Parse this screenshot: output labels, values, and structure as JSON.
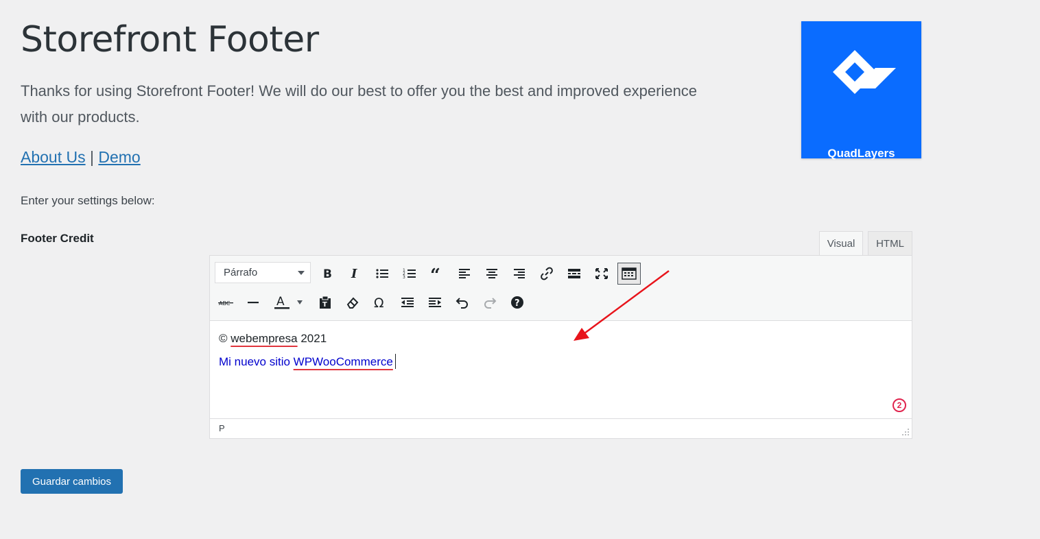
{
  "page": {
    "title": "Storefront Footer",
    "intro": "Thanks for using Storefront Footer! We will do our best to offer you the best and improved experience with our products.",
    "links": {
      "about": "About Us",
      "separator": "|",
      "demo": "Demo"
    },
    "enter_settings": "Enter your settings below:"
  },
  "logo": {
    "text": "QuadLayers",
    "bg_color": "#0a6cff"
  },
  "field": {
    "label": "Footer Credit"
  },
  "editor": {
    "tabs": {
      "visual": "Visual",
      "html": "HTML"
    },
    "format_select": "Párrafo",
    "toolbar_row1": [
      "bold-icon",
      "italic-icon",
      "bullet-list-icon",
      "numbered-list-icon",
      "blockquote-icon",
      "align-left-icon",
      "align-center-icon",
      "align-right-icon",
      "link-icon",
      "read-more-icon",
      "fullscreen-icon",
      "toolbar-toggle-icon"
    ],
    "toolbar_row2": [
      "strikethrough-icon",
      "horizontal-line-icon",
      "text-color-icon",
      "paste-text-icon",
      "clear-formatting-icon",
      "special-character-icon",
      "outdent-icon",
      "indent-icon",
      "undo-icon",
      "redo-icon",
      "help-icon"
    ],
    "content": {
      "line1_symbol": "©",
      "line1_word": "webempresa",
      "line1_year": "2021",
      "line2_prefix": "Mi nuevo sitio",
      "line2_word": "WPWooCommerce",
      "line2_color": "#0000cd"
    },
    "badge": "2",
    "status_path": "P"
  },
  "actions": {
    "save": "Guardar cambios",
    "accent_color": "#2271b1"
  },
  "annotation": {
    "arrow_color": "#e8141b"
  }
}
